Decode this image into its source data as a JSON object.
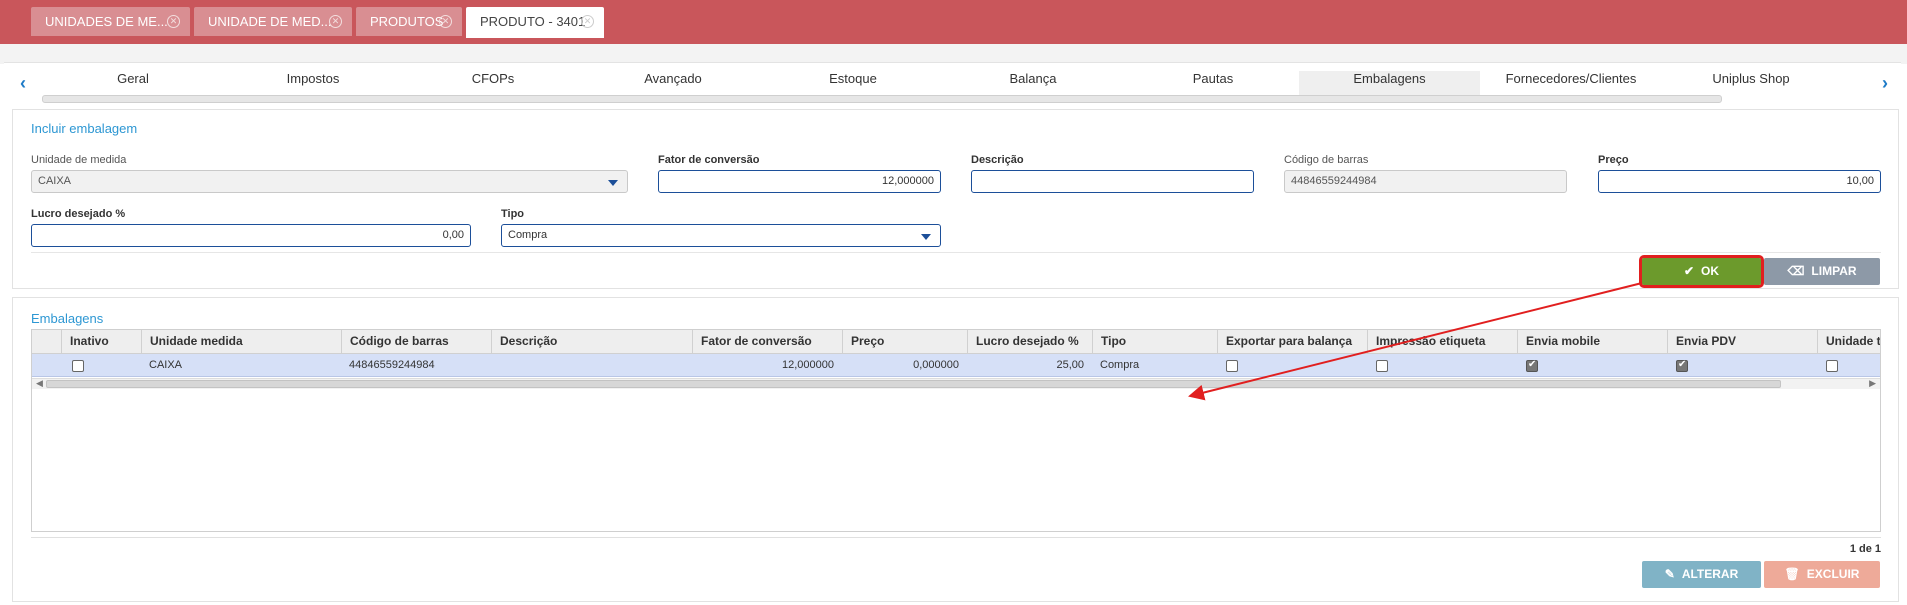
{
  "top_tabs": [
    {
      "label": "UNIDADES DE ME...",
      "active": false
    },
    {
      "label": "UNIDADE DE MED...",
      "active": false
    },
    {
      "label": "PRODUTOS",
      "active": false
    },
    {
      "label": "PRODUTO - 3401",
      "active": true
    }
  ],
  "inner_tabs": [
    "Geral",
    "Impostos",
    "CFOPs",
    "Avançado",
    "Estoque",
    "Balança",
    "Pautas",
    "Embalagens",
    "Fornecedores/Clientes",
    "Uniplus Shop"
  ],
  "active_inner_tab": "Embalagens",
  "nav": {
    "left_arrow": "‹",
    "right_arrow": "›"
  },
  "form": {
    "title": "Incluir embalagem",
    "unidade_label": "Unidade de medida",
    "unidade_value": "CAIXA",
    "fator_label": "Fator de conversão",
    "fator_value": "12,000000",
    "descricao_label": "Descrição",
    "descricao_value": "",
    "codigo_label": "Código de barras",
    "codigo_value": "44846559244984",
    "preco_label": "Preço",
    "preco_value": "10,00",
    "lucro_label": "Lucro desejado %",
    "lucro_value": "0,00",
    "tipo_label": "Tipo",
    "tipo_value": "Compra",
    "ok_label": "OK",
    "limpar_label": "LIMPAR"
  },
  "table": {
    "title": "Embalagens",
    "columns": [
      "Inativo",
      "Unidade medida",
      "Código de barras",
      "Descrição",
      "Fator de conversão",
      "Preço",
      "Lucro desejado %",
      "Tipo",
      "Exportar para balança",
      "Impressão etiqueta",
      "Envia mobile",
      "Envia PDV",
      "Unidade t"
    ],
    "row": {
      "inativo": false,
      "unidade": "CAIXA",
      "codigo": "44846559244984",
      "descricao": "",
      "fator": "12,000000",
      "preco": "0,000000",
      "lucro": "25,00",
      "tipo": "Compra",
      "exportar": false,
      "impressao": false,
      "envia_mobile": true,
      "envia_pdv": true,
      "unidade_t": false
    },
    "pagination": "1 de 1",
    "alterar_label": "ALTERAR",
    "excluir_label": "EXCLUIR"
  },
  "colors": {
    "topbar": "#c9565b",
    "accent_blue": "#2d97d3",
    "ok_green": "#6c9a2c",
    "highlight_red": "#e11f1f",
    "row_selected": "#d6e0f7"
  },
  "icons": {
    "ok": "check-icon",
    "limpar": "eraser-icon",
    "alterar": "pencil-icon",
    "excluir": "trash-icon",
    "close": "close-icon"
  }
}
